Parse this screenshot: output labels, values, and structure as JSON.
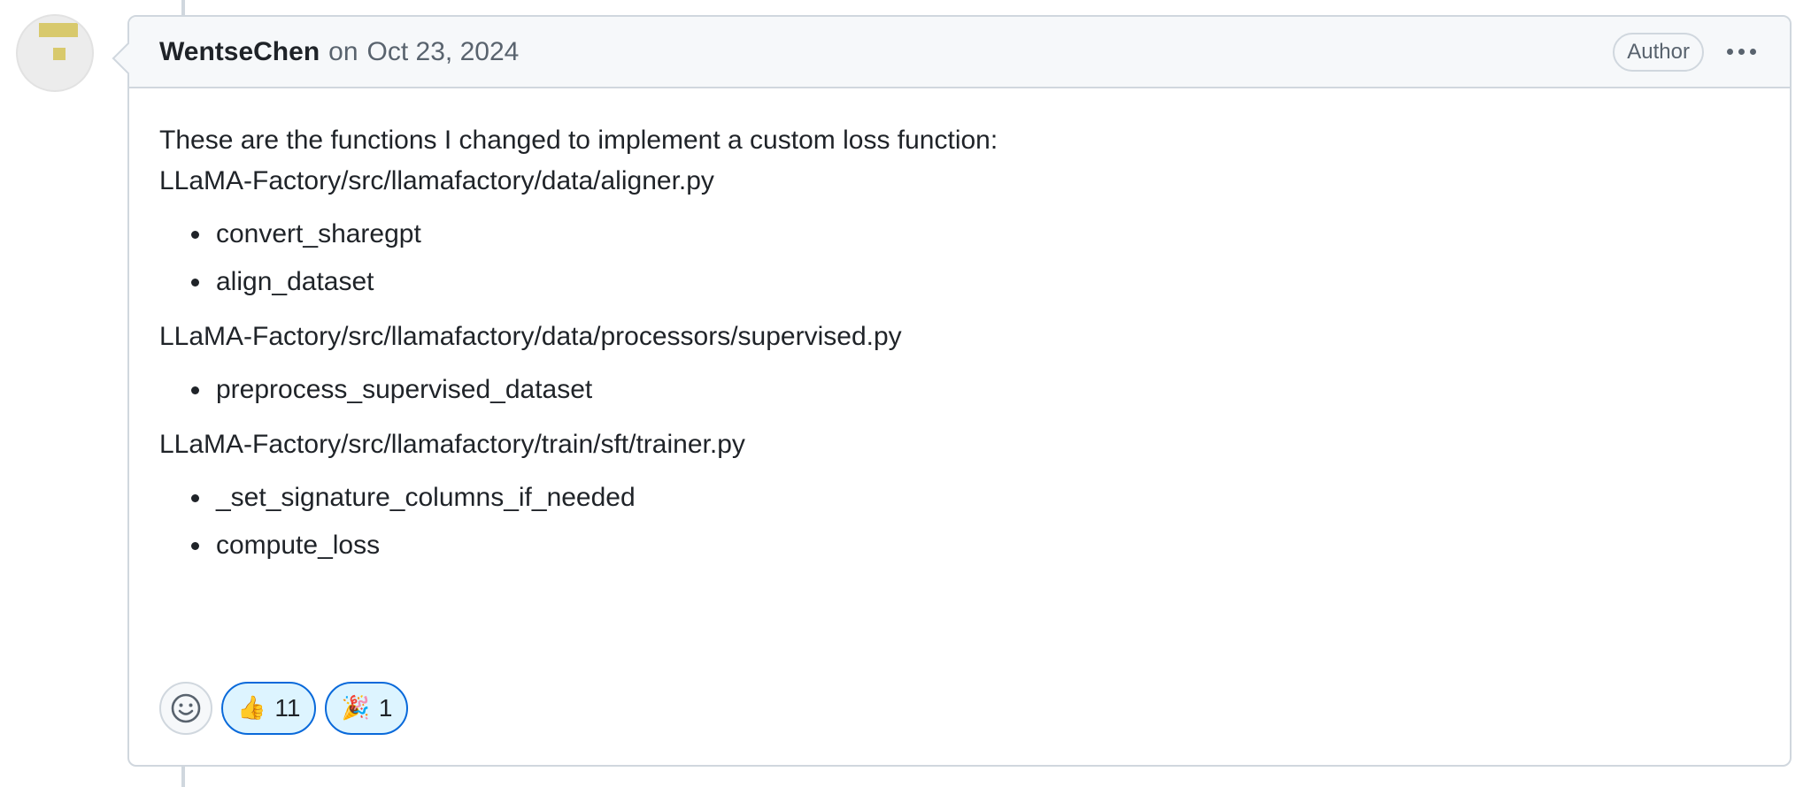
{
  "comment": {
    "author": "WentseChen",
    "on_text": "on",
    "date": "Oct 23, 2024",
    "badge": "Author",
    "body": {
      "intro": "These are the functions I changed to implement a custom loss function:",
      "sections": [
        {
          "path": "LLaMA-Factory/src/llamafactory/data/aligner.py",
          "items": [
            "convert_sharegpt",
            "align_dataset"
          ]
        },
        {
          "path": "LLaMA-Factory/src/llamafactory/data/processors/supervised.py",
          "items": [
            "preprocess_supervised_dataset"
          ]
        },
        {
          "path": "LLaMA-Factory/src/llamafactory/train/sft/trainer.py",
          "items": [
            "_set_signature_columns_if_needed",
            "compute_loss"
          ]
        }
      ]
    },
    "reactions": [
      {
        "emoji": "👍",
        "icon": "thumbs-up-icon",
        "count": "11"
      },
      {
        "emoji": "🎉",
        "icon": "party-popper-icon",
        "count": "1"
      }
    ]
  },
  "colors": {
    "accent": "#0969da",
    "reaction_bg": "#ddf4ff",
    "header_bg": "#f6f8fa",
    "border": "#d0d7de",
    "muted_text": "#59636e"
  }
}
